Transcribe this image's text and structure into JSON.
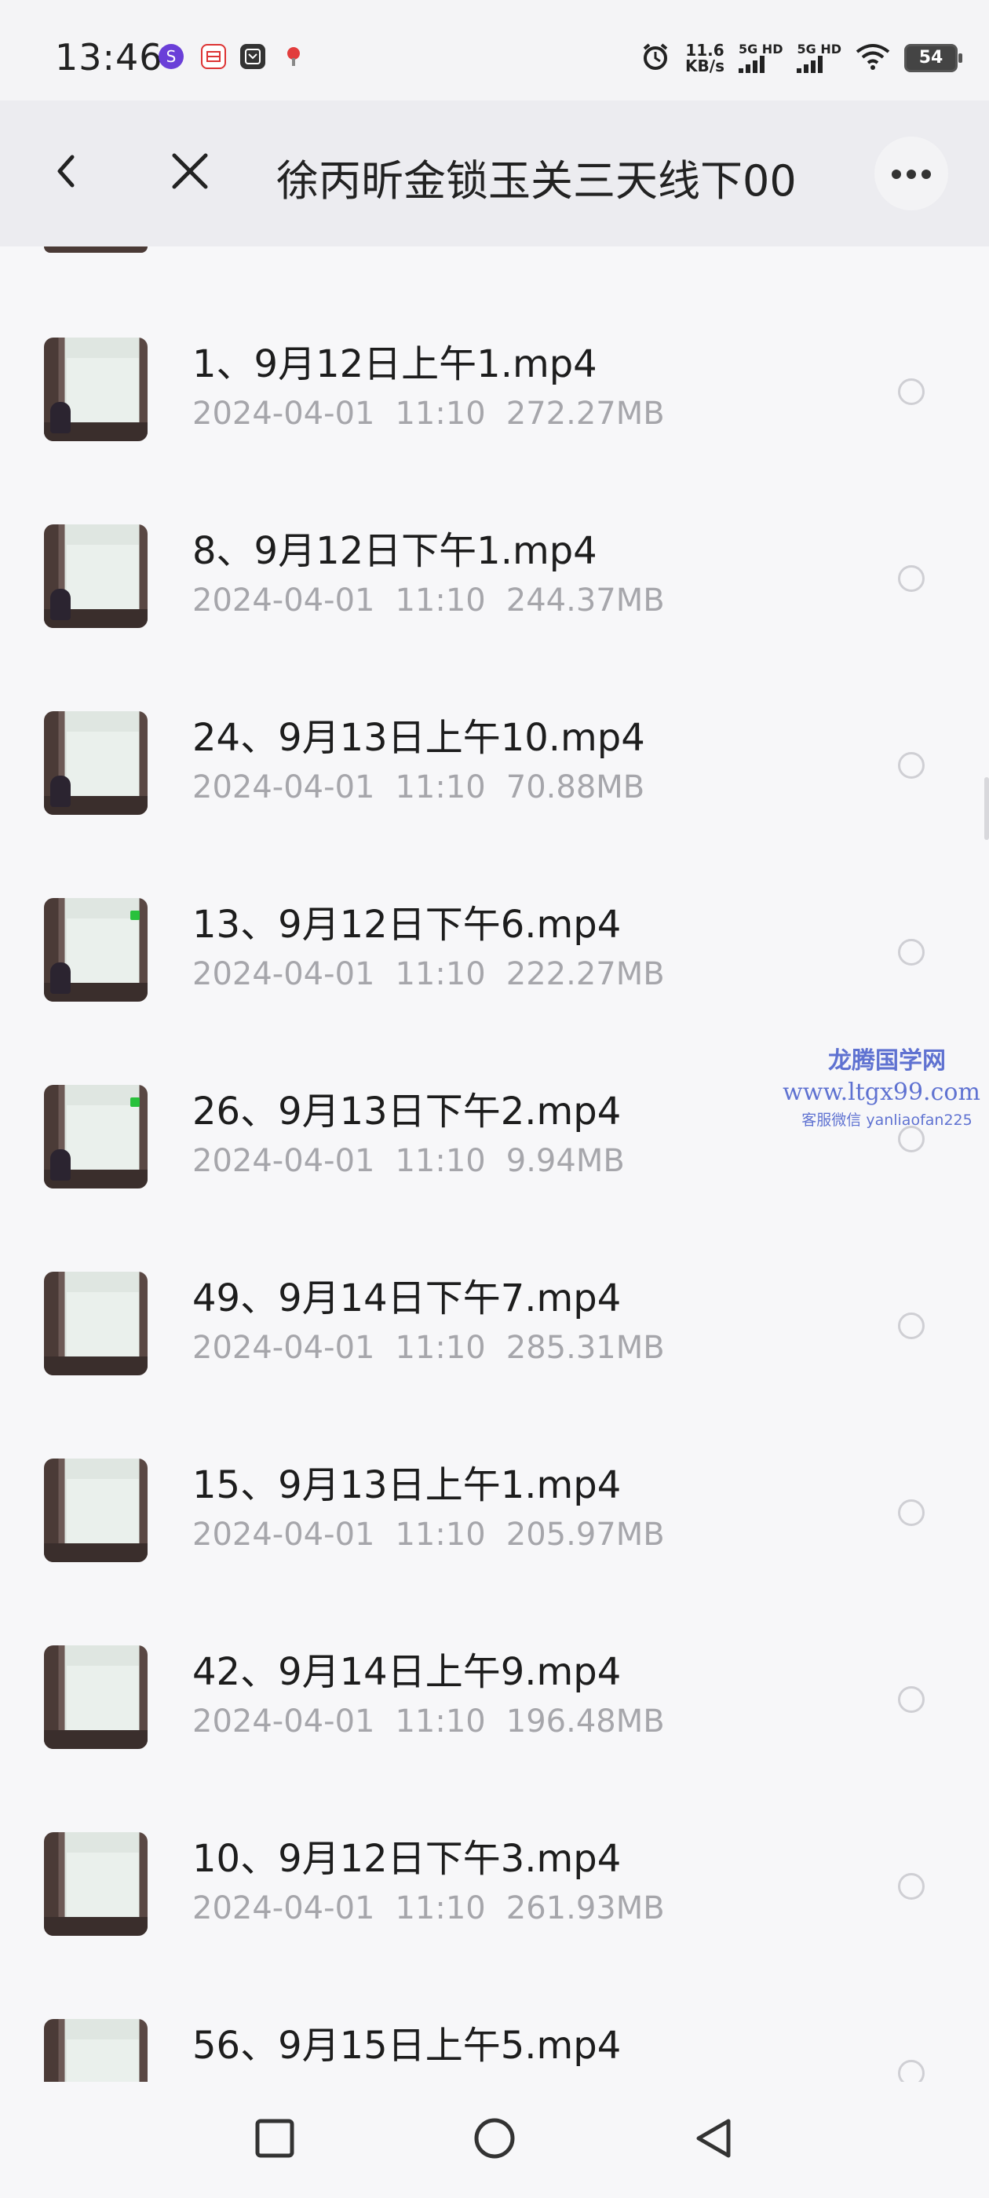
{
  "status_bar": {
    "time": "13:46",
    "app_icons": [
      "app-s-icon",
      "app-qianliao-icon",
      "app-box-icon",
      "app-map-pin-icon"
    ],
    "net_speed_value": "11.6",
    "net_speed_unit": "KB/s",
    "sim1_label": "5G HD",
    "sim2_label": "5G HD",
    "battery": "54"
  },
  "header": {
    "title": "徐丙昕金锁玉关三天线下00"
  },
  "files": [
    {
      "name": "1、9月12日上午1.mp4",
      "date": "2024-04-01",
      "time": "11:10",
      "size": "272.27MB"
    },
    {
      "name": "8、9月12日下午1.mp4",
      "date": "2024-04-01",
      "time": "11:10",
      "size": "244.37MB"
    },
    {
      "name": "24、9月13日上午10.mp4",
      "date": "2024-04-01",
      "time": "11:10",
      "size": "70.88MB"
    },
    {
      "name": "13、9月12日下午6.mp4",
      "date": "2024-04-01",
      "time": "11:10",
      "size": "222.27MB"
    },
    {
      "name": "26、9月13日下午2.mp4",
      "date": "2024-04-01",
      "time": "11:10",
      "size": "9.94MB"
    },
    {
      "name": "49、9月14日下午7.mp4",
      "date": "2024-04-01",
      "time": "11:10",
      "size": "285.31MB"
    },
    {
      "name": "15、9月13日上午1.mp4",
      "date": "2024-04-01",
      "time": "11:10",
      "size": "205.97MB"
    },
    {
      "name": "42、9月14日上午9.mp4",
      "date": "2024-04-01",
      "time": "11:10",
      "size": "196.48MB"
    },
    {
      "name": "10、9月12日下午3.mp4",
      "date": "2024-04-01",
      "time": "11:10",
      "size": "261.93MB"
    },
    {
      "name": "56、9月15日上午5.mp4",
      "date": "",
      "time": "",
      "size": ""
    }
  ],
  "watermark": {
    "line1": "龙腾国学网",
    "line2": "www.ltgx99.com",
    "line3": "客服微信 yanliaofan225"
  },
  "nav": {
    "icons": [
      "recents-square-icon",
      "home-circle-icon",
      "back-triangle-icon"
    ]
  }
}
